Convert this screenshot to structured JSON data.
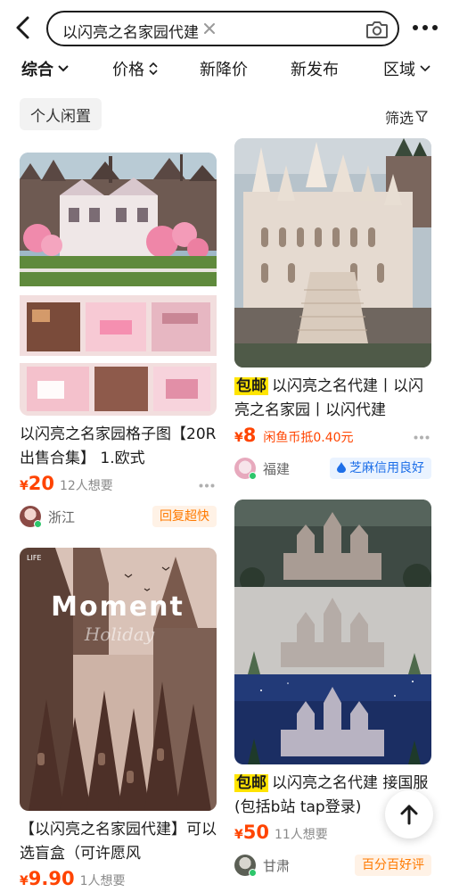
{
  "search": {
    "query": "以闪亮之名家园代建"
  },
  "sort": {
    "items": [
      {
        "label": "综合",
        "active": true,
        "icon": "chevron-down-icon"
      },
      {
        "label": "价格",
        "active": false,
        "icon": "sort-updown-icon"
      },
      {
        "label": "新降价",
        "active": false
      },
      {
        "label": "新发布",
        "active": false
      },
      {
        "label": "区域",
        "active": false,
        "icon": "chevron-down-icon"
      }
    ]
  },
  "chip": {
    "label": "个人闲置"
  },
  "filter": {
    "label": "筛选",
    "icon": "funnel-icon"
  },
  "colors": {
    "price": "#ff4400",
    "baoyou_bg": "#ffe400",
    "online": "#2ec66b"
  },
  "cards": [
    {
      "title": "以闪亮之名家园格子图【20R出售合集】 1.欧式",
      "price_symbol": "¥",
      "price": "20",
      "want": "12人想要",
      "region": "浙江",
      "badge": "回复超快"
    },
    {
      "tag": "包邮",
      "title": "以闪亮之名代建丨以闪亮之名家园丨以闪代建",
      "price_symbol": "¥",
      "price": "8",
      "coin": "闲鱼币抵0.40元",
      "region": "福建",
      "badge": "芝麻信用良好"
    },
    {
      "title": "【以闪亮之名家园代建】可以选盲盒（可许愿风",
      "price_symbol": "¥",
      "price": "9.90",
      "want": "1人想要",
      "image_text": {
        "headline": "Moment",
        "sub": "Holiday",
        "corner": "LIFE"
      }
    },
    {
      "tag": "包邮",
      "title": "以闪亮之名代建 接国服(包括b站 tap登录)",
      "price_symbol": "¥",
      "price": "50",
      "want": "11人想要",
      "region": "甘肃",
      "badge": "百分百好评"
    }
  ]
}
